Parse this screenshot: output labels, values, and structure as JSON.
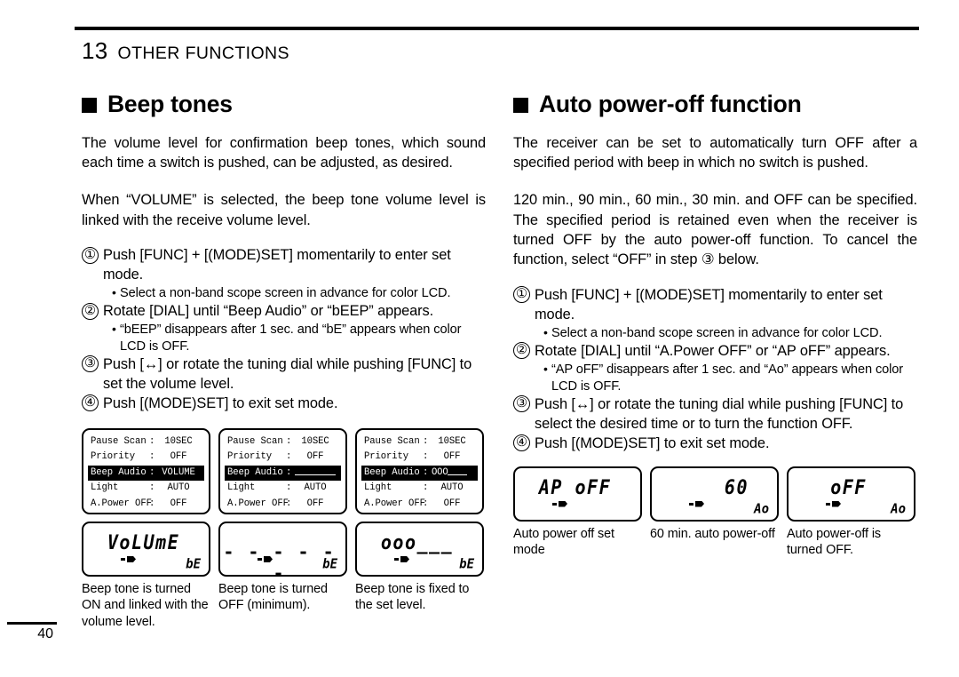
{
  "page": {
    "chapter_number": "13",
    "chapter_title": "OTHER FUNCTIONS",
    "page_number": "40"
  },
  "left": {
    "section_title": "Beep tones",
    "intro1": "The volume level for confirmation beep tones, which sound each time a switch is pushed, can be adjusted, as desired.",
    "intro2": "When “VOLUME” is selected, the beep tone volume level is linked with the receive volume level.",
    "steps": [
      {
        "num": "①",
        "text": "Push [FUNC] + [(MODE)SET] momentarily to enter set mode.",
        "notes": [
          "Select a non-band scope screen in advance for color LCD."
        ]
      },
      {
        "num": "②",
        "text": "Rotate [DIAL] until “Beep Audio” or “bEEP” appears.",
        "notes": [
          "“bEEP” disappears after 1 sec. and “bE” appears when color LCD is OFF."
        ]
      },
      {
        "num": "③",
        "text": "Push [↔] or rotate the tuning dial while pushing [FUNC] to set the volume level.",
        "notes": []
      },
      {
        "num": "④",
        "text": "Push [(MODE)SET] to exit set mode.",
        "notes": []
      }
    ],
    "menu_screens": [
      {
        "rows": [
          {
            "label": "Pause Scan",
            "colon": ":",
            "value": "10SEC",
            "highlight": false
          },
          {
            "label": "Priority",
            "colon": ":",
            "value": "OFF",
            "highlight": false
          },
          {
            "label": "Beep Audio",
            "colon": ":",
            "value": "VOLUME",
            "highlight": true
          },
          {
            "label": "Light",
            "colon": ":",
            "value": "AUTO",
            "highlight": false
          },
          {
            "label": "A.Power OFF",
            "colon": ":",
            "value": "OFF",
            "highlight": false
          }
        ]
      },
      {
        "rows": [
          {
            "label": "Pause Scan",
            "colon": ":",
            "value": "10SEC",
            "highlight": false
          },
          {
            "label": "Priority",
            "colon": ":",
            "value": "OFF",
            "highlight": false
          },
          {
            "label": "Beep Audio",
            "colon": ":",
            "value": "",
            "highlight": true,
            "bar": "empty"
          },
          {
            "label": "Light",
            "colon": ":",
            "value": "AUTO",
            "highlight": false
          },
          {
            "label": "A.Power OFF",
            "colon": ":",
            "value": "OFF",
            "highlight": false
          }
        ]
      },
      {
        "rows": [
          {
            "label": "Pause Scan",
            "colon": ":",
            "value": "10SEC",
            "highlight": false
          },
          {
            "label": "Priority",
            "colon": ":",
            "value": "OFF",
            "highlight": false
          },
          {
            "label": "Beep Audio",
            "colon": ":",
            "value": "OOO",
            "highlight": true,
            "bar": "partial"
          },
          {
            "label": "Light",
            "colon": ":",
            "value": "AUTO",
            "highlight": false
          },
          {
            "label": "A.Power OFF",
            "colon": ":",
            "value": "OFF",
            "highlight": false
          }
        ]
      }
    ],
    "seg_screens": [
      {
        "main": "VoLUmE",
        "sub": "bE",
        "style": "text",
        "caption": "Beep tone is turned ON and linked with the volume level."
      },
      {
        "main": "- - - - - -",
        "sub": "bE",
        "style": "dashes",
        "caption": "Beep tone is turned OFF (minimum)."
      },
      {
        "main": "ooo___",
        "sub": "bE",
        "style": "text",
        "caption": "Beep tone is fixed to the set level."
      }
    ]
  },
  "right": {
    "section_title": "Auto power-off function",
    "intro1": "The receiver can be set to automatically turn OFF after a specified period with beep in which no switch is pushed.",
    "intro2": "120 min., 90 min., 60 min., 30 min. and OFF can be specified. The specified period is retained even when the receiver is turned OFF by the auto power-off function. To cancel the function, select “OFF” in step ③ below.",
    "steps": [
      {
        "num": "①",
        "text": "Push [FUNC] + [(MODE)SET] momentarily to enter set mode.",
        "notes": [
          "Select a non-band scope screen in advance for color LCD."
        ]
      },
      {
        "num": "②",
        "text": "Rotate [DIAL] until “A.Power OFF” or “AP oFF” appears.",
        "notes": [
          "“AP oFF” disappears after 1 sec. and “Ao” appears when color LCD is OFF."
        ]
      },
      {
        "num": "③",
        "text": "Push [↔] or rotate the tuning dial while pushing [FUNC] to select the desired time or to turn the function OFF.",
        "notes": []
      },
      {
        "num": "④",
        "text": "Push [(MODE)SET] to exit set mode.",
        "notes": []
      }
    ],
    "seg_screens": [
      {
        "main": "AP oFF",
        "sub": "",
        "align": "center",
        "caption": "Auto power off set mode"
      },
      {
        "main": "60",
        "sub": "Ao",
        "align": "right",
        "caption": "60 min. auto power-off"
      },
      {
        "main": "oFF",
        "sub": "Ao",
        "align": "center",
        "caption": "Auto power-off is turned OFF."
      }
    ]
  }
}
